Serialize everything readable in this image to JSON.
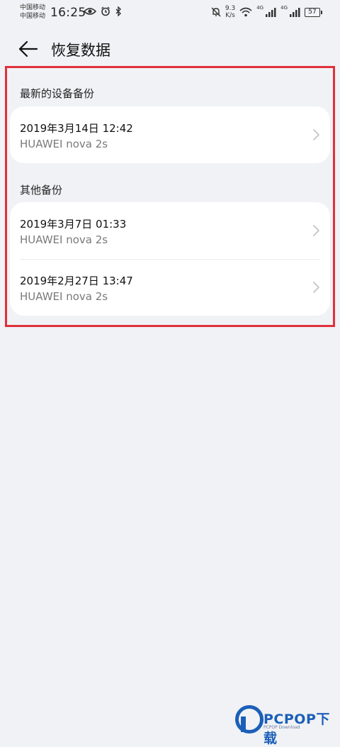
{
  "status_bar": {
    "carrier1": "中国移动",
    "carrier2": "中国移动",
    "time": "16:25",
    "net_speed_value": "9.3",
    "net_speed_unit": "K/s",
    "signal1_label": "4G",
    "signal2_label": "4G",
    "battery": "57"
  },
  "header": {
    "title": "恢复数据"
  },
  "sections": [
    {
      "title": "最新的设备备份",
      "items": [
        {
          "date": "2019年3月14日 12:42",
          "device": "HUAWEI nova 2s"
        }
      ]
    },
    {
      "title": "其他备份",
      "items": [
        {
          "date": "2019年3月7日 01:33",
          "device": "HUAWEI nova 2s"
        },
        {
          "date": "2019年2月27日 13:47",
          "device": "HUAWEI nova 2s"
        }
      ]
    }
  ],
  "watermark": {
    "brand": "PCPOP下载",
    "sub": "PCPOP Download"
  },
  "colors": {
    "background": "#f1f2f5",
    "highlight": "#e0313c",
    "brand": "#1b5fb8"
  }
}
